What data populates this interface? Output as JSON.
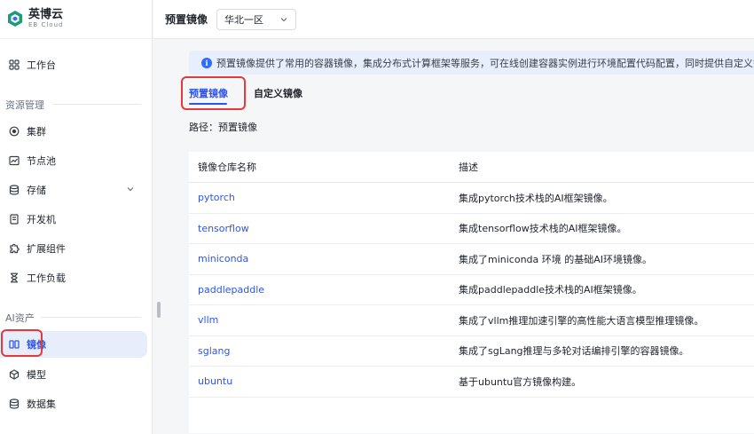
{
  "brand": {
    "name": "英博云",
    "sub": "EB Cloud"
  },
  "sidebar": {
    "top_items": [
      {
        "label": "工作台",
        "icon": "grid-icon"
      }
    ],
    "sections": [
      {
        "label": "资源管理"
      },
      {
        "label": "AI资产"
      }
    ],
    "resource_items": [
      {
        "label": "集群",
        "icon": "cluster-icon"
      },
      {
        "label": "节点池",
        "icon": "chart-icon"
      },
      {
        "label": "存储",
        "icon": "database-icon"
      },
      {
        "label": "开发机",
        "icon": "notebook-icon"
      },
      {
        "label": "扩展组件",
        "icon": "puzzle-icon"
      },
      {
        "label": "工作负载",
        "icon": "hourglass-icon"
      }
    ],
    "ai_items": [
      {
        "label": "镜像",
        "icon": "mirror-icon",
        "active": true
      },
      {
        "label": "模型",
        "icon": "cube-icon"
      },
      {
        "label": "数据集",
        "icon": "dataset-icon"
      }
    ]
  },
  "header": {
    "title": "预置镜像",
    "region": "华北一区"
  },
  "notice": {
    "text": "预置镜像提供了常用的容器镜像，集成分布式计算框架等服务，可在线创建容器实例进行环境配置代码配置，同时提供自定义镜像仓"
  },
  "tabs": [
    {
      "label": "预置镜像",
      "active": true
    },
    {
      "label": "自定义镜像",
      "active": false
    }
  ],
  "path": {
    "label": "路径：",
    "value": "预置镜像"
  },
  "table": {
    "columns": [
      "镜像仓库名称",
      "描述"
    ],
    "rows": [
      {
        "name": "pytorch",
        "desc": "集成pytorch技术栈的AI框架镜像。"
      },
      {
        "name": "tensorflow",
        "desc": "集成tensorflow技术栈的AI框架镜像。"
      },
      {
        "name": "miniconda",
        "desc": "集成了miniconda 环境 的基础AI环境镜像。"
      },
      {
        "name": "paddlepaddle",
        "desc": "集成paddlepaddle技术栈的AI框架镜像。"
      },
      {
        "name": "vllm",
        "desc": "集成了vllm推理加速引擎的高性能大语言模型推理镜像。"
      },
      {
        "name": "sglang",
        "desc": "集成了sgLang推理与多轮对话编排引擎的容器镜像。"
      },
      {
        "name": "ubuntu",
        "desc": "基于ubuntu官方镜像构建。"
      }
    ]
  },
  "colors": {
    "accent": "#2f54eb",
    "highlight": "#e5393b",
    "notice_bg": "#e8effc"
  }
}
